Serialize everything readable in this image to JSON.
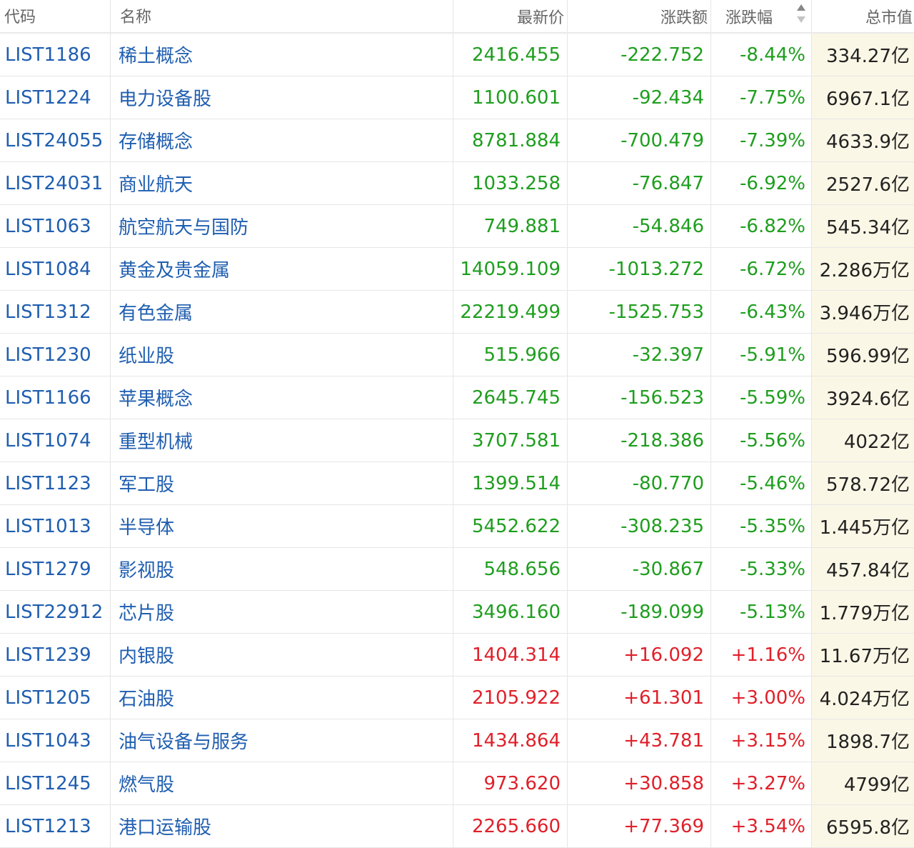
{
  "header": {
    "code": "代码",
    "name": "名称",
    "price": "最新价",
    "change": "涨跌额",
    "change_pct": "涨跌幅",
    "market_cap": "总市值"
  },
  "colors": {
    "link": "#1f5eb0",
    "down": "#1e9e1e",
    "up": "#e0202a",
    "highlight_column_bg": "#fbf7e6"
  },
  "sort_icon": "sort-up-down-icon",
  "rows": [
    {
      "code": "LIST1186",
      "name": "稀土概念",
      "price": "2416.455",
      "change": "-222.752",
      "pct": "-8.44%",
      "cap": "334.27亿",
      "dir": "down"
    },
    {
      "code": "LIST1224",
      "name": "电力设备股",
      "price": "1100.601",
      "change": "-92.434",
      "pct": "-7.75%",
      "cap": "6967.1亿",
      "dir": "down"
    },
    {
      "code": "LIST24055",
      "name": "存储概念",
      "price": "8781.884",
      "change": "-700.479",
      "pct": "-7.39%",
      "cap": "4633.9亿",
      "dir": "down"
    },
    {
      "code": "LIST24031",
      "name": "商业航天",
      "price": "1033.258",
      "change": "-76.847",
      "pct": "-6.92%",
      "cap": "2527.6亿",
      "dir": "down"
    },
    {
      "code": "LIST1063",
      "name": "航空航天与国防",
      "price": "749.881",
      "change": "-54.846",
      "pct": "-6.82%",
      "cap": "545.34亿",
      "dir": "down"
    },
    {
      "code": "LIST1084",
      "name": "黄金及贵金属",
      "price": "14059.109",
      "change": "-1013.272",
      "pct": "-6.72%",
      "cap": "2.286万亿",
      "dir": "down"
    },
    {
      "code": "LIST1312",
      "name": "有色金属",
      "price": "22219.499",
      "change": "-1525.753",
      "pct": "-6.43%",
      "cap": "3.946万亿",
      "dir": "down"
    },
    {
      "code": "LIST1230",
      "name": "纸业股",
      "price": "515.966",
      "change": "-32.397",
      "pct": "-5.91%",
      "cap": "596.99亿",
      "dir": "down"
    },
    {
      "code": "LIST1166",
      "name": "苹果概念",
      "price": "2645.745",
      "change": "-156.523",
      "pct": "-5.59%",
      "cap": "3924.6亿",
      "dir": "down"
    },
    {
      "code": "LIST1074",
      "name": "重型机械",
      "price": "3707.581",
      "change": "-218.386",
      "pct": "-5.56%",
      "cap": "4022亿",
      "dir": "down"
    },
    {
      "code": "LIST1123",
      "name": "军工股",
      "price": "1399.514",
      "change": "-80.770",
      "pct": "-5.46%",
      "cap": "578.72亿",
      "dir": "down"
    },
    {
      "code": "LIST1013",
      "name": "半导体",
      "price": "5452.622",
      "change": "-308.235",
      "pct": "-5.35%",
      "cap": "1.445万亿",
      "dir": "down"
    },
    {
      "code": "LIST1279",
      "name": "影视股",
      "price": "548.656",
      "change": "-30.867",
      "pct": "-5.33%",
      "cap": "457.84亿",
      "dir": "down"
    },
    {
      "code": "LIST22912",
      "name": "芯片股",
      "price": "3496.160",
      "change": "-189.099",
      "pct": "-5.13%",
      "cap": "1.779万亿",
      "dir": "down"
    },
    {
      "code": "LIST1239",
      "name": "内银股",
      "price": "1404.314",
      "change": "+16.092",
      "pct": "+1.16%",
      "cap": "11.67万亿",
      "dir": "up"
    },
    {
      "code": "LIST1205",
      "name": "石油股",
      "price": "2105.922",
      "change": "+61.301",
      "pct": "+3.00%",
      "cap": "4.024万亿",
      "dir": "up"
    },
    {
      "code": "LIST1043",
      "name": "油气设备与服务",
      "price": "1434.864",
      "change": "+43.781",
      "pct": "+3.15%",
      "cap": "1898.7亿",
      "dir": "up"
    },
    {
      "code": "LIST1245",
      "name": "燃气股",
      "price": "973.620",
      "change": "+30.858",
      "pct": "+3.27%",
      "cap": "4799亿",
      "dir": "up"
    },
    {
      "code": "LIST1213",
      "name": "港口运输股",
      "price": "2265.660",
      "change": "+77.369",
      "pct": "+3.54%",
      "cap": "6595.8亿",
      "dir": "up"
    }
  ]
}
